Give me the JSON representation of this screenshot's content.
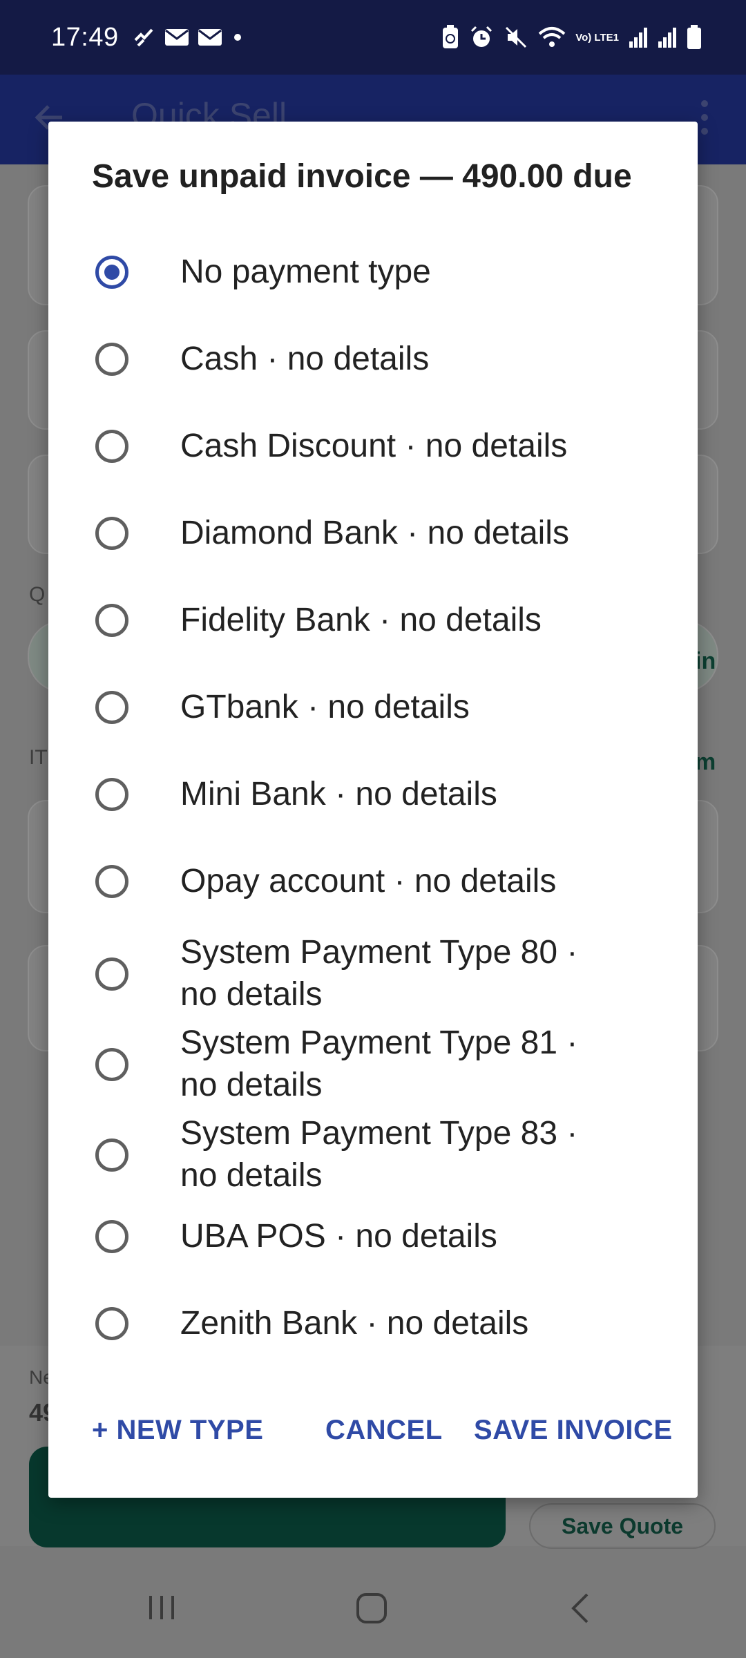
{
  "status_bar": {
    "time": "17:49",
    "network_label": "Vo) LTE1"
  },
  "app": {
    "title": "Quick Sell",
    "ghost_labels": [
      "Q",
      "IT",
      "in",
      "m",
      "Ne",
      "49"
    ],
    "save_quote_label": "Save Quote"
  },
  "dialog": {
    "title": "Save unpaid invoice — 490.00 due",
    "options": [
      {
        "label": "No payment type",
        "selected": true
      },
      {
        "label": "Cash  ·  no details",
        "selected": false
      },
      {
        "label": "Cash Discount  ·  no details",
        "selected": false
      },
      {
        "label": "Diamond Bank  ·  no details",
        "selected": false
      },
      {
        "label": "Fidelity Bank  ·  no details",
        "selected": false
      },
      {
        "label": "GTbank  ·  no details",
        "selected": false
      },
      {
        "label": "Mini Bank  ·  no details",
        "selected": false
      },
      {
        "label": "Opay account   ·  no details",
        "selected": false
      },
      {
        "label": "System Payment Type 80  ·  no details",
        "selected": false
      },
      {
        "label": "System Payment Type 81  ·  no details",
        "selected": false
      },
      {
        "label": "System Payment Type 83  ·  no details",
        "selected": false
      },
      {
        "label": "UBA POS  ·  no details",
        "selected": false
      },
      {
        "label": "Zenith Bank  ·  no details",
        "selected": false
      }
    ],
    "actions": {
      "new_type": "+ NEW TYPE",
      "cancel": "CANCEL",
      "save": "SAVE INVOICE"
    }
  },
  "colors": {
    "accent": "#2f4aa6",
    "status_bar": "#141a45",
    "app_bar": "#172363",
    "primary_button": "#07382d"
  }
}
